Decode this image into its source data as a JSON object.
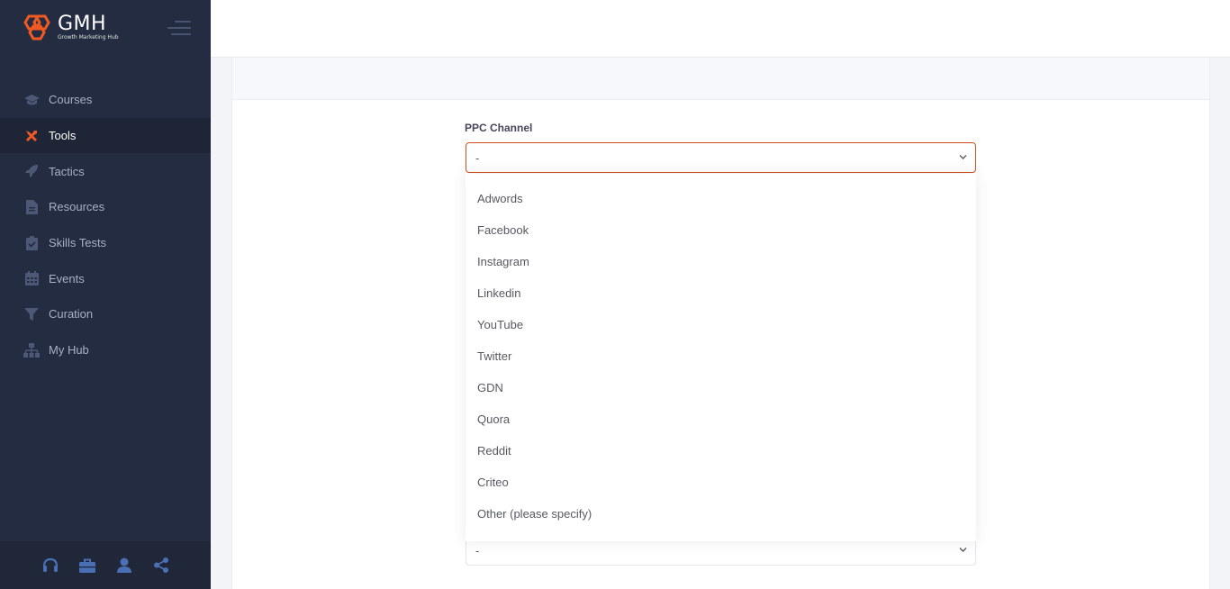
{
  "brand": {
    "name": "GMH",
    "tagline": "Growth Marketing Hub",
    "accent": "#f05a22"
  },
  "sidebar": {
    "items": [
      {
        "label": "Courses",
        "icon": "graduation-cap-icon",
        "active": false
      },
      {
        "label": "Tools",
        "icon": "tools-icon",
        "active": true
      },
      {
        "label": "Tactics",
        "icon": "rocket-icon",
        "active": false
      },
      {
        "label": "Resources",
        "icon": "file-icon",
        "active": false
      },
      {
        "label": "Skills Tests",
        "icon": "clipboard-check-icon",
        "active": false
      },
      {
        "label": "Events",
        "icon": "calendar-icon",
        "active": false
      },
      {
        "label": "Curation",
        "icon": "filter-icon",
        "active": false
      },
      {
        "label": "My Hub",
        "icon": "sitemap-icon",
        "active": false
      }
    ],
    "footer_icons": [
      "headset-icon",
      "briefcase-icon",
      "user-icon",
      "share-icon"
    ]
  },
  "form": {
    "ppc_channel": {
      "label": "PPC Channel",
      "value": "-",
      "options": [
        "Adwords",
        "Facebook",
        "Instagram",
        "Linkedin",
        "YouTube",
        "Twitter",
        "GDN",
        "Quora",
        "Reddit",
        "Criteo",
        "Other (please specify)"
      ]
    },
    "second_select": {
      "value": "-"
    }
  },
  "colors": {
    "sidebar_bg": "#232c40",
    "focus_border": "#d14f1e",
    "active_icon": "#f05a22"
  }
}
